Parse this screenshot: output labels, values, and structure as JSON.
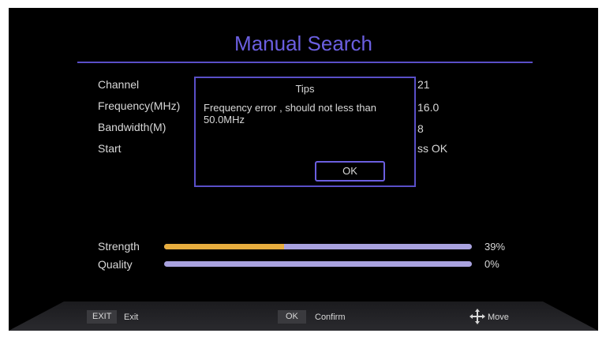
{
  "screen": {
    "title": "Manual Search",
    "rows": [
      {
        "label": "Channel",
        "value": "21"
      },
      {
        "label": "Frequency(MHz)",
        "value": "16.0"
      },
      {
        "label": "Bandwidth(M)",
        "value": "8"
      },
      {
        "label": "Start",
        "value": "ss OK"
      }
    ]
  },
  "dialog": {
    "title": "Tips",
    "message": "Frequency error , should not less than 50.0MHz",
    "ok_label": "OK"
  },
  "meters": [
    {
      "label": "Strength",
      "percent_text": "39%",
      "level": 0.39
    },
    {
      "label": "Quality",
      "percent_text": "0%",
      "level": 0.0
    }
  ],
  "footer": {
    "exit_key": "EXIT",
    "exit_desc": "Exit",
    "ok_key": "OK",
    "ok_desc": "Confirm",
    "move_desc": "Move",
    "move_icon": "move-arrows-icon"
  },
  "colors": {
    "accent": "#6b5fe0",
    "strength_fill": "#e7ad3e",
    "track": "#a9a2df"
  }
}
